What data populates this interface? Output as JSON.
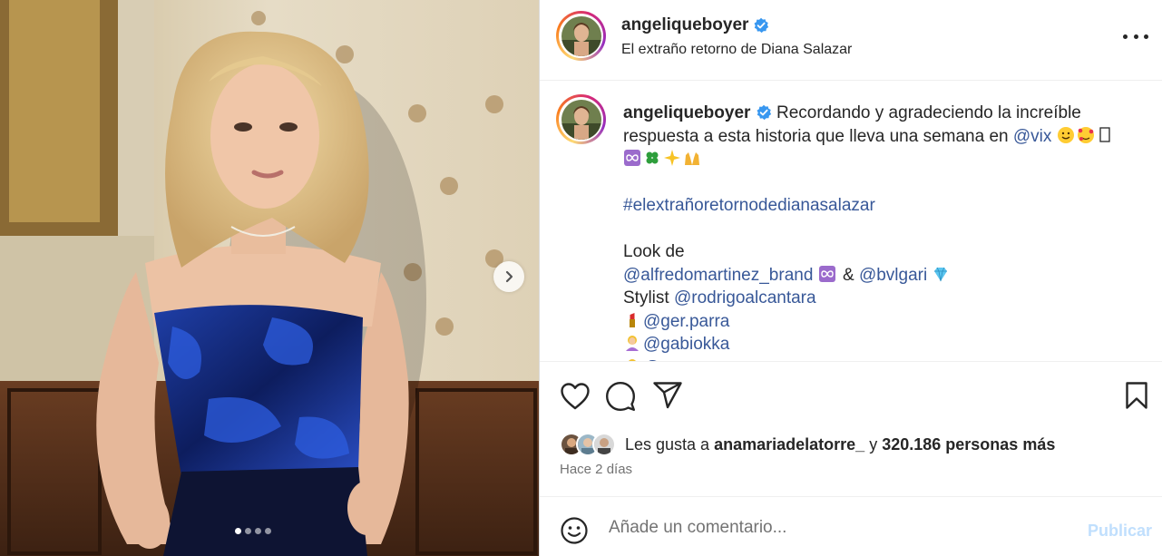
{
  "post": {
    "username": "angeliqueboyer",
    "location": "El extraño retorno de Diana Salazar",
    "carousel": {
      "total_slides": 4,
      "active_slide": 1
    }
  },
  "caption": {
    "username": "angeliqueboyer",
    "line1": "Recordando y agradeciendo la increíble respuesta a esta historia que lleva una semana en",
    "mention_vix": "@vix",
    "hashtag": "#elextrañoretornodedianasalazar",
    "look_label": "Look de",
    "mention_alfredo": "@alfredomartinez_brand",
    "amp": "&",
    "mention_bvlgari": "@bvlgari",
    "stylist_label": "Stylist",
    "mention_rodrigo": "@rodrigoalcantara",
    "mention_ger": "@ger.parra",
    "mention_gabi": "@gabiokka",
    "mention_cut": "@..."
  },
  "likes": {
    "prefix": "Les gusta a",
    "first_user": "anamariadelatorre_",
    "joiner": "y",
    "others": "320.186 personas más"
  },
  "timestamp": "Hace 2 días",
  "comment": {
    "placeholder": "Añade un comentario...",
    "publish_label": "Publicar"
  },
  "icons": {
    "verified": "verified-badge-icon",
    "more": "more-options-icon",
    "next": "chevron-right-icon",
    "like": "heart-outline-icon",
    "comment": "speech-bubble-icon",
    "share": "paper-plane-icon",
    "save": "bookmark-icon",
    "emoji": "smiley-icon"
  },
  "colors": {
    "verified": "#3897f0",
    "link": "#385898",
    "publish_disabled": "#c0dffd",
    "muted": "#737373"
  }
}
